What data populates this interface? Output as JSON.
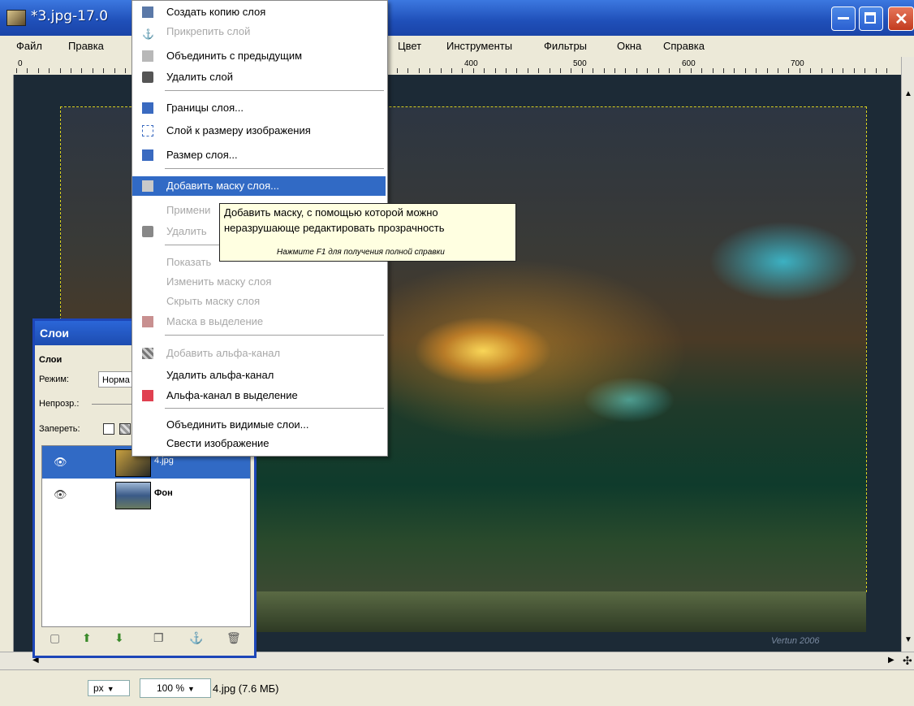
{
  "window": {
    "title": "*3.jpg-17.0"
  },
  "menubar": {
    "items": [
      "Файл",
      "Правка",
      "Цвет",
      "Инструменты",
      "Фильтры",
      "Окна",
      "Справка"
    ]
  },
  "ruler": {
    "labels": [
      "0",
      "400",
      "500",
      "600",
      "700"
    ]
  },
  "context_menu": {
    "items": [
      {
        "label": "Создать копию слоя",
        "enabled": true,
        "icon": "duplicate-layer-icon"
      },
      {
        "label": "Прикрепить слой",
        "enabled": false,
        "icon": "anchor-icon"
      },
      {
        "label": "Объединить с предыдущим",
        "enabled": true,
        "icon": "merge-down-icon"
      },
      {
        "label": "Удалить слой",
        "enabled": true,
        "icon": "trash-icon"
      },
      {
        "label": "Границы слоя...",
        "enabled": true,
        "icon": "layer-boundary-icon"
      },
      {
        "label": "Слой к размеру изображения",
        "enabled": true,
        "icon": "layer-to-image-size-icon"
      },
      {
        "label": "Размер слоя...",
        "enabled": true,
        "icon": "scale-layer-icon"
      },
      {
        "label": "Добавить маску слоя...",
        "enabled": true,
        "highlighted": true,
        "icon": "add-mask-icon"
      },
      {
        "label": "Примени",
        "enabled": false,
        "icon": ""
      },
      {
        "label": "Удалить",
        "enabled": false,
        "icon": "trash-icon"
      },
      {
        "label": "Показать",
        "enabled": false,
        "icon": ""
      },
      {
        "label": "Изменить маску слоя",
        "enabled": false,
        "icon": ""
      },
      {
        "label": "Скрыть маску слоя",
        "enabled": false,
        "icon": ""
      },
      {
        "label": "Маска в выделение",
        "enabled": false,
        "icon": "mask-to-selection-icon"
      },
      {
        "label": "Добавить альфа-канал",
        "enabled": false,
        "icon": "alpha-icon"
      },
      {
        "label": "Удалить альфа-канал",
        "enabled": true,
        "icon": ""
      },
      {
        "label": "Альфа-канал в выделение",
        "enabled": true,
        "icon": "alpha-to-selection-icon"
      },
      {
        "label": "Объединить видимые слои...",
        "enabled": true,
        "icon": ""
      },
      {
        "label": "Свести изображение",
        "enabled": true,
        "icon": ""
      }
    ]
  },
  "tooltip": {
    "line1": "Добавить маску, с помощью которой можно",
    "line2": "неразрушающе редактировать прозрачность",
    "hint": "Нажмите F1 для получения полной справки"
  },
  "layers_dialog": {
    "title": "Слои",
    "section": "Слои",
    "mode_label": "Режим:",
    "mode_value": "Норма",
    "opacity_label": "Непрозр.:",
    "lock_label": "Запереть:",
    "layers": [
      {
        "name": "4.jpg",
        "selected": true
      },
      {
        "name": "Фон",
        "selected": false
      }
    ]
  },
  "canvas": {
    "watermark": "Vertun 2006"
  },
  "statusbar": {
    "unit": "px",
    "zoom": "100 %",
    "text": "4.jpg (7.6 МБ)"
  },
  "colors": {
    "highlight": "#316ac5",
    "titlebar": "#1f4fb8",
    "tooltip_bg": "#ffffe1"
  }
}
